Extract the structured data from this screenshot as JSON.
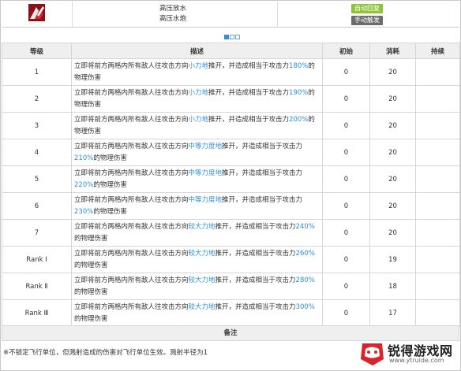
{
  "skill": {
    "name": "高压放水",
    "subname": "高压水炮",
    "badges": {
      "auto": "自动回复",
      "manual": "手动触发"
    }
  },
  "table": {
    "headers": {
      "level": "等级",
      "desc": "描述",
      "initial": "初始",
      "cost": "消耗",
      "duration": "持续"
    },
    "rows": [
      {
        "level": "1",
        "pre": "立即将前方两格内所有敌人往攻击方向",
        "force": "小力地",
        "mid": "推开，并造成相当于攻击力",
        "pct": "180%",
        "post": "的物理伤害",
        "initial": "0",
        "cost": "20",
        "duration": ""
      },
      {
        "level": "2",
        "pre": "立即将前方两格内所有敌人往攻击方向",
        "force": "小力地",
        "mid": "推开，并造成相当于攻击力",
        "pct": "190%",
        "post": "的物理伤害",
        "initial": "0",
        "cost": "20",
        "duration": ""
      },
      {
        "level": "3",
        "pre": "立即将前方两格内所有敌人往攻击方向",
        "force": "小力地",
        "mid": "推开，并造成相当于攻击力",
        "pct": "200%",
        "post": "的物理伤害",
        "initial": "0",
        "cost": "20",
        "duration": ""
      },
      {
        "level": "4",
        "pre": "立即将前方两格内所有敌人往攻击方向",
        "force": "中等力度地",
        "mid": "推开，并造成相当于攻击力",
        "pct": "210%",
        "post": "的物理伤害",
        "initial": "0",
        "cost": "20",
        "duration": ""
      },
      {
        "level": "5",
        "pre": "立即将前方两格内所有敌人往攻击方向",
        "force": "中等力度地",
        "mid": "推开，并造成相当于攻击力",
        "pct": "220%",
        "post": "的物理伤害",
        "initial": "0",
        "cost": "20",
        "duration": ""
      },
      {
        "level": "6",
        "pre": "立即将前方两格内所有敌人往攻击方向",
        "force": "中等力度地",
        "mid": "推开，并造成相当于攻击力",
        "pct": "230%",
        "post": "的物理伤害",
        "initial": "0",
        "cost": "20",
        "duration": ""
      },
      {
        "level": "7",
        "pre": "立即将前方两格内所有敌人往攻击方向",
        "force": "较大力地",
        "mid": "推开，并造成相当于攻击力",
        "pct": "240%",
        "post": "的物理伤害",
        "initial": "0",
        "cost": "20",
        "duration": ""
      },
      {
        "level": "Rank Ⅰ",
        "pre": "立即将前方两格内所有敌人往攻击方向",
        "force": "较大力地",
        "mid": "推开，并造成相当于攻击力",
        "pct": "260%",
        "post": "的物理伤害",
        "initial": "0",
        "cost": "19",
        "duration": ""
      },
      {
        "level": "Rank Ⅱ",
        "pre": "立即将前方两格内所有敌人往攻击方向",
        "force": "较大力地",
        "mid": "推开，并造成相当于攻击力",
        "pct": "280%",
        "post": "的物理伤害",
        "initial": "0",
        "cost": "18",
        "duration": ""
      },
      {
        "level": "Rank Ⅲ",
        "pre": "立即将前方两格内所有敌人往攻击方向",
        "force": "较大力地",
        "mid": "推开，并造成相当于攻击力",
        "pct": "300%",
        "post": "的物理伤害",
        "initial": "0",
        "cost": "17",
        "duration": ""
      }
    ]
  },
  "notes": {
    "heading": "备注",
    "text": "※不锁定飞行单位，但溅射造成的伤害对飞行单位生效。溅射半径为1"
  },
  "watermark": {
    "title": "锐得游戏网",
    "url": "www.ytruide.com"
  },
  "colors": {
    "highlight": "#2f8fd8",
    "auto_badge": "#90c437",
    "manual_badge": "#6b6b6b",
    "icon_bg": "#8c1018"
  },
  "pager": {
    "pages": 3,
    "current": 1
  }
}
